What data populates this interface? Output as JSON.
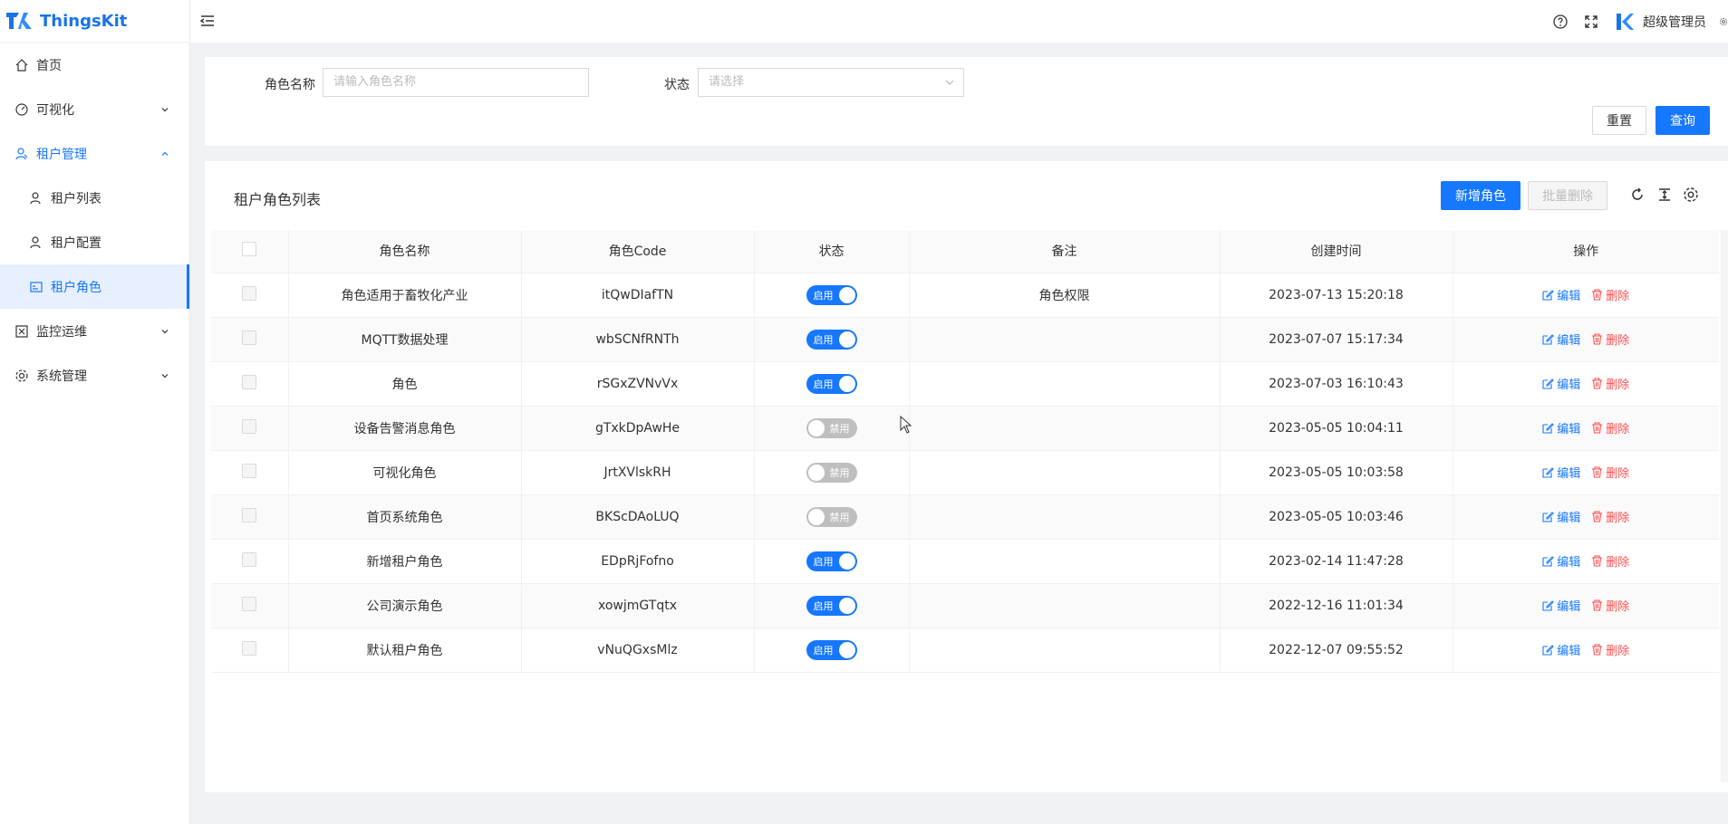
{
  "app": {
    "name": "ThingsKit"
  },
  "header": {
    "username": "超级管理员"
  },
  "sidebar": {
    "items": [
      {
        "label": "首页",
        "icon": "home-icon"
      },
      {
        "label": "可视化",
        "icon": "dashboard-icon"
      },
      {
        "label": "租户管理",
        "icon": "tenant-icon"
      },
      {
        "label": "监控运维",
        "icon": "monitor-icon"
      },
      {
        "label": "系统管理",
        "icon": "gear-icon"
      }
    ],
    "submenu": [
      {
        "label": "租户列表",
        "icon": "tenant-list-icon"
      },
      {
        "label": "租户配置",
        "icon": "user-config-icon"
      },
      {
        "label": "租户角色",
        "icon": "role-card-icon"
      }
    ]
  },
  "search": {
    "role_name_label": "角色名称",
    "role_name_placeholder": "请输入角色名称",
    "status_label": "状态",
    "status_placeholder": "请选择",
    "reset_label": "重置",
    "query_label": "查询"
  },
  "table": {
    "title": "租户角色列表",
    "add_label": "新增角色",
    "batch_delete_label": "批量删除",
    "columns": [
      "角色名称",
      "角色Code",
      "状态",
      "备注",
      "创建时间",
      "操作"
    ],
    "edit_label": "编辑",
    "delete_label": "删除",
    "rows": [
      {
        "name": "角色适用于畜牧化产业",
        "code": "itQwDIafTN",
        "status": "启用",
        "enabled": true,
        "remark": "角色权限",
        "created": "2023-07-13 15:20:18"
      },
      {
        "name": "MQTT数据处理",
        "code": "wbSCNfRNTh",
        "status": "启用",
        "enabled": true,
        "remark": "",
        "created": "2023-07-07 15:17:34"
      },
      {
        "name": "角色",
        "code": "rSGxZVNvVx",
        "status": "启用",
        "enabled": true,
        "remark": "",
        "created": "2023-07-03 16:10:43"
      },
      {
        "name": "设备告警消息角色",
        "code": "gTxkDpAwHe",
        "status": "禁用",
        "enabled": false,
        "remark": "",
        "created": "2023-05-05 10:04:11"
      },
      {
        "name": "可视化角色",
        "code": "JrtXVlskRH",
        "status": "禁用",
        "enabled": false,
        "remark": "",
        "created": "2023-05-05 10:03:58"
      },
      {
        "name": "首页系统角色",
        "code": "BKScDAoLUQ",
        "status": "禁用",
        "enabled": false,
        "remark": "",
        "created": "2023-05-05 10:03:46"
      },
      {
        "name": "新增租户角色",
        "code": "EDpRjFofno",
        "status": "启用",
        "enabled": true,
        "remark": "",
        "created": "2023-02-14 11:47:28"
      },
      {
        "name": "公司演示角色",
        "code": "xowjmGTqtx",
        "status": "启用",
        "enabled": true,
        "remark": "",
        "created": "2022-12-16 11:01:34"
      },
      {
        "name": "默认租户角色",
        "code": "vNuQGxsMlz",
        "status": "启用",
        "enabled": true,
        "remark": "",
        "created": "2022-12-07 09:55:52"
      }
    ]
  },
  "colors": {
    "primary": "#1677ff",
    "danger": "#ff4d4f",
    "switch_off": "#bfbfbf"
  }
}
